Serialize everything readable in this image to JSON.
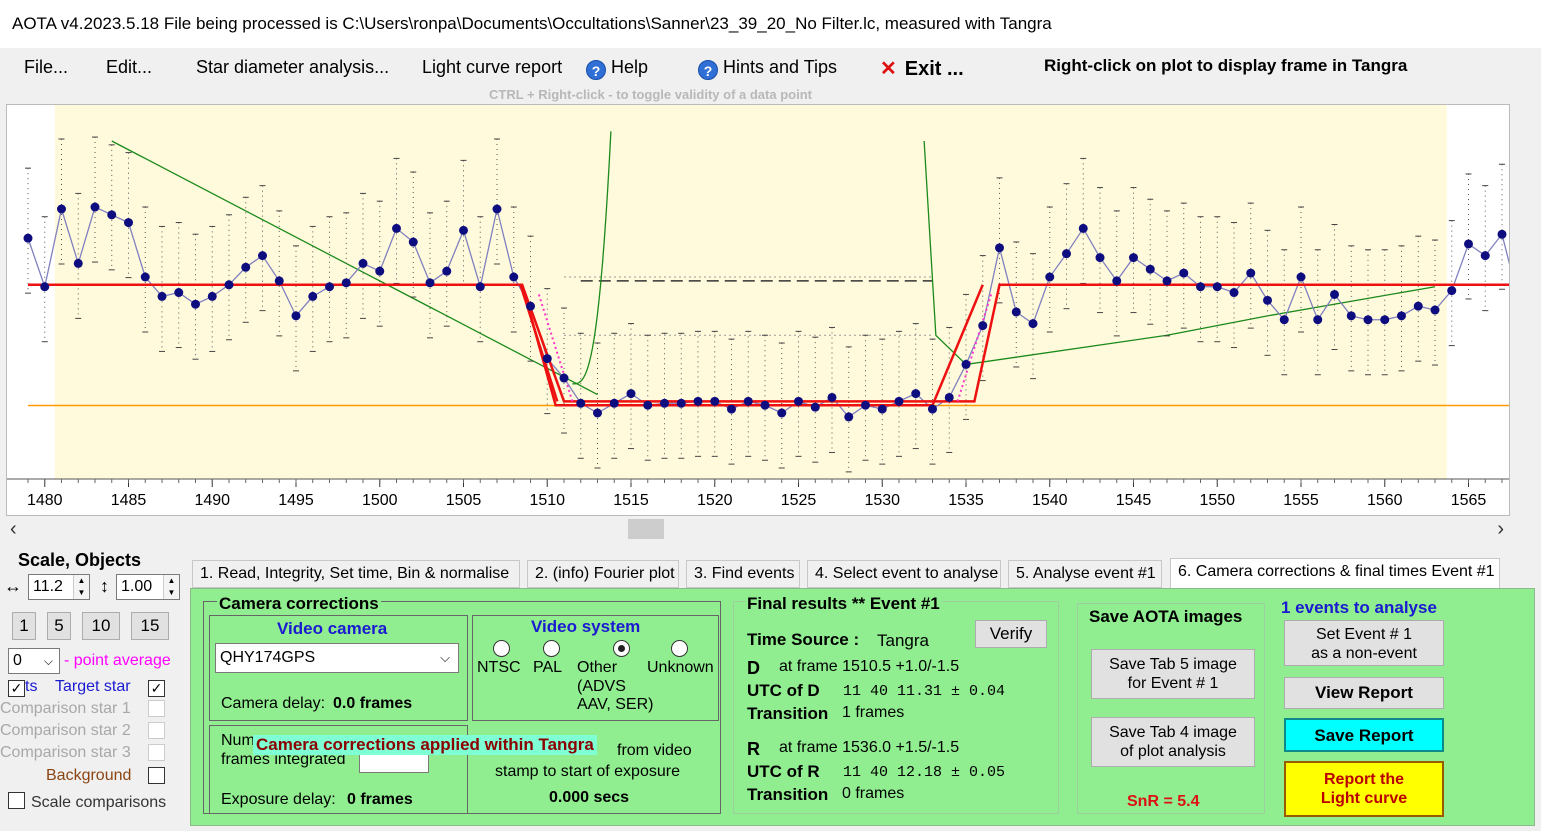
{
  "window": {
    "title": "AOTA v4.2023.5.18     File being processed is C:\\Users\\ronpa\\Documents\\Occultations\\Sanner\\23_39_20_No Filter.lc, measured with Tangra"
  },
  "menu": {
    "file": "File...",
    "edit": "Edit...",
    "star_diameter": "Star diameter analysis...",
    "light_curve_report": "Light curve report",
    "help": "Help",
    "hints": "Hints and Tips",
    "exit": "Exit ...",
    "help_icon": "?",
    "exit_icon": "✕"
  },
  "hint_text": "CTRL + Right-click  -  to toggle validity of a data point",
  "right_click_note": "Right-click on plot to display frame in Tangra",
  "plot": {
    "x_ticks": [
      "1480",
      "1485",
      "1490",
      "1495",
      "1500",
      "1505",
      "1510",
      "1515",
      "1520",
      "1525",
      "1530",
      "1535",
      "1540",
      "1545",
      "1550",
      "1555",
      "1560",
      "1565"
    ],
    "x_range": [
      1479,
      1568
    ],
    "y_range": [
      -0.45,
      1.3
    ],
    "points": [
      [
        1479,
        0.8
      ],
      [
        1480,
        0.55
      ],
      [
        1481,
        0.95
      ],
      [
        1482,
        0.67
      ],
      [
        1483,
        0.96
      ],
      [
        1484,
        0.92
      ],
      [
        1485,
        0.88
      ],
      [
        1486,
        0.6
      ],
      [
        1487,
        0.5
      ],
      [
        1488,
        0.52
      ],
      [
        1489,
        0.46
      ],
      [
        1490,
        0.5
      ],
      [
        1491,
        0.56
      ],
      [
        1492,
        0.65
      ],
      [
        1493,
        0.71
      ],
      [
        1494,
        0.58
      ],
      [
        1495,
        0.4
      ],
      [
        1496,
        0.5
      ],
      [
        1497,
        0.55
      ],
      [
        1498,
        0.57
      ],
      [
        1499,
        0.67
      ],
      [
        1500,
        0.63
      ],
      [
        1501,
        0.85
      ],
      [
        1502,
        0.78
      ],
      [
        1503,
        0.57
      ],
      [
        1504,
        0.63
      ],
      [
        1505,
        0.84
      ],
      [
        1506,
        0.55
      ],
      [
        1507,
        0.95
      ],
      [
        1508,
        0.6
      ],
      [
        1509,
        0.45
      ],
      [
        1510,
        0.18
      ],
      [
        1511,
        0.08
      ],
      [
        1512,
        -0.05
      ],
      [
        1513,
        -0.1
      ],
      [
        1514,
        -0.05
      ],
      [
        1515,
        0.0
      ],
      [
        1516,
        -0.06
      ],
      [
        1517,
        -0.05
      ],
      [
        1518,
        -0.05
      ],
      [
        1519,
        -0.04
      ],
      [
        1520,
        -0.04
      ],
      [
        1521,
        -0.08
      ],
      [
        1522,
        -0.04
      ],
      [
        1523,
        -0.06
      ],
      [
        1524,
        -0.1
      ],
      [
        1525,
        -0.04
      ],
      [
        1526,
        -0.07
      ],
      [
        1527,
        -0.02
      ],
      [
        1528,
        -0.12
      ],
      [
        1529,
        -0.06
      ],
      [
        1530,
        -0.08
      ],
      [
        1531,
        -0.04
      ],
      [
        1532,
        0.0
      ],
      [
        1533,
        -0.08
      ],
      [
        1534,
        -0.02
      ],
      [
        1535,
        0.15
      ],
      [
        1536,
        0.35
      ],
      [
        1537,
        0.75
      ],
      [
        1538,
        0.42
      ],
      [
        1539,
        0.36
      ],
      [
        1540,
        0.6
      ],
      [
        1541,
        0.72
      ],
      [
        1542,
        0.85
      ],
      [
        1543,
        0.7
      ],
      [
        1544,
        0.58
      ],
      [
        1545,
        0.7
      ],
      [
        1546,
        0.64
      ],
      [
        1547,
        0.58
      ],
      [
        1548,
        0.62
      ],
      [
        1549,
        0.55
      ],
      [
        1550,
        0.55
      ],
      [
        1551,
        0.52
      ],
      [
        1552,
        0.62
      ],
      [
        1553,
        0.48
      ],
      [
        1554,
        0.38
      ],
      [
        1555,
        0.6
      ],
      [
        1556,
        0.38
      ],
      [
        1557,
        0.51
      ],
      [
        1558,
        0.4
      ],
      [
        1559,
        0.38
      ],
      [
        1560,
        0.38
      ],
      [
        1561,
        0.4
      ],
      [
        1562,
        0.45
      ],
      [
        1563,
        0.43
      ],
      [
        1564,
        0.53
      ],
      [
        1565,
        0.77
      ],
      [
        1566,
        0.71
      ],
      [
        1567,
        0.82
      ],
      [
        1568,
        0.48
      ]
    ],
    "baseline_level": 0.56,
    "bottom_level": -0.04,
    "d_frame": 1510.5,
    "r_frame": 1536.0
  },
  "left": {
    "scale_objects": "Scale,  Objects",
    "h_scale": "11.2",
    "v_scale": "1.00",
    "h_icon": "↔",
    "v_icon": "↕",
    "btn1": "1",
    "btn5": "5",
    "btn10": "10",
    "btn15": "15",
    "avg_value": "0",
    "avg_label": "- point average",
    "pts_label": "ts",
    "target_star": "Target star",
    "comp1": "Comparison star 1",
    "comp2": "Comparison star 2",
    "comp3": "Comparison star 3",
    "background": "Background",
    "scale_comparisons": "Scale comparisons"
  },
  "tabs": {
    "t1": "1.  Read, Integrity, Set time, Bin & normalise",
    "t2": "2. (info)  Fourier plot",
    "t3": "3. Find events",
    "t4": "4. Select event to analyse",
    "t5": "5. Analyse event #1",
    "t6": "6. Camera corrections & final times Event #1"
  },
  "camera": {
    "header": "Camera corrections",
    "video_camera": "Video camera",
    "camera_value": "QHY174GPS",
    "camera_delay_label": "Camera delay:",
    "camera_delay_value": "0.0 frames",
    "video_system": "Video system",
    "ntsc": "NTSC",
    "pal": "PAL",
    "other": "Other",
    "other_sub1": "(ADVS",
    "other_sub2": "AAV, SER)",
    "unknown": "Unknown",
    "num_frames_1": "Num",
    "num_frames_2": "frames integrated",
    "tangra_banner": "Camera corrections applied within Tangra",
    "from_video": "from video",
    "stamp_text": "stamp to start of exposure",
    "secs": "0.000 secs",
    "exposure_delay_label": "Exposure delay:",
    "exposure_delay_value": "0 frames"
  },
  "final": {
    "header": "Final results  **  Event #1",
    "time_source_label": "Time Source :",
    "time_source_value": "Tangra",
    "verify": "Verify",
    "d_label": "D",
    "d_text": "at frame 1510.5  +1.0/-1.5",
    "utc_d_label": "UTC of D",
    "utc_d_value": "11 40 11.31  ± 0.04",
    "trans_label": "Transition",
    "trans_d": "1 frames",
    "r_label": "R",
    "r_text": "at frame 1536.0  +1.5/-1.5",
    "utc_r_label": "UTC of R",
    "utc_r_value": "11 40 12.18  ± 0.05",
    "trans_r": "0 frames"
  },
  "save": {
    "header": "Save AOTA images",
    "tab5_l1": "Save Tab 5 image",
    "tab5_l2": "for Event # 1",
    "tab4_l1": "Save Tab 4 image",
    "tab4_l2": "of plot analysis",
    "snr": "SnR = 5.4"
  },
  "actions": {
    "events_count": "1  events to analyse",
    "set_nonevent_l1": "Set Event # 1",
    "set_nonevent_l2": "as a non-event",
    "view_report": "View Report",
    "save_report": "Save Report",
    "report_l1": "Report the",
    "report_l2": "Light curve"
  },
  "colors": {
    "plot_bg": "#fffadc",
    "model_red": "#ee1111",
    "trace": "#8080c0",
    "point": "#0d0d80",
    "green_curve": "#1a8a1a",
    "orange_line": "#ff9900",
    "magenta_dots": "#ff33cc",
    "panel_green": "#90ee90",
    "save_report_bg": "#00ffff",
    "report_lc_bg": "#ffff00"
  }
}
